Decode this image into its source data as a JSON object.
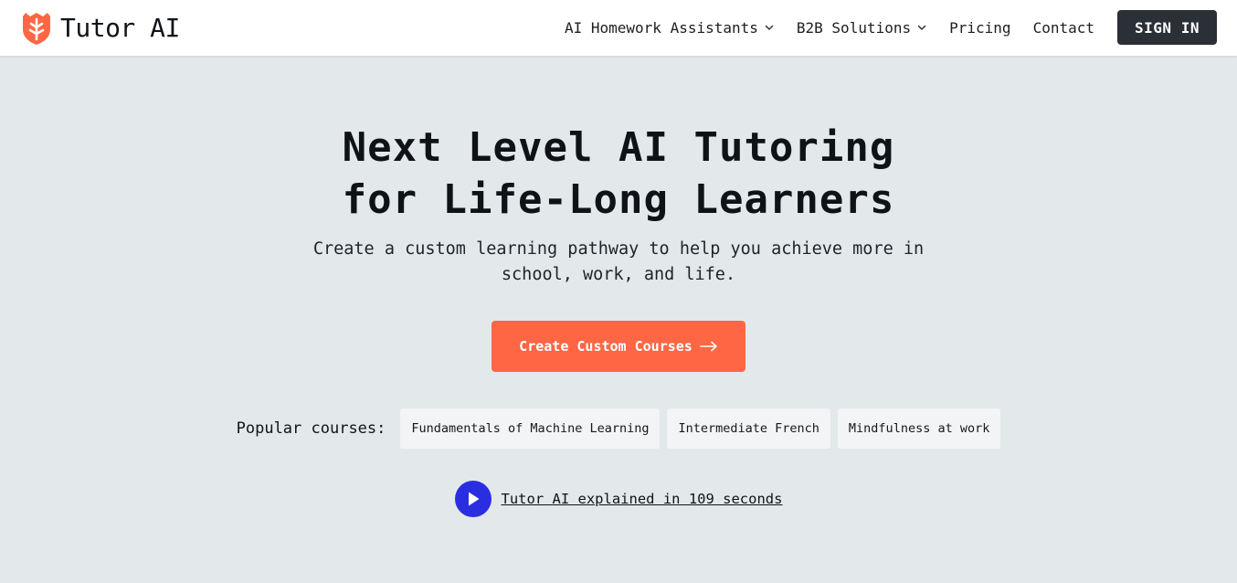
{
  "brand": {
    "name": "Tutor AI",
    "accent_color": "#ff6644"
  },
  "nav": {
    "items": [
      {
        "label": "AI Homework Assistants",
        "has_dropdown": true
      },
      {
        "label": "B2B Solutions",
        "has_dropdown": true
      },
      {
        "label": "Pricing",
        "has_dropdown": false
      },
      {
        "label": "Contact",
        "has_dropdown": false
      }
    ],
    "signin_label": "SIGN IN"
  },
  "hero": {
    "title_line1": "Next Level AI Tutoring",
    "title_line2": "for Life-Long Learners",
    "subtitle_line1": "Create a custom learning pathway to help you achieve more in",
    "subtitle_line2": "school, work, and life.",
    "cta_label": "Create Custom Courses",
    "cta_color": "#ff6644"
  },
  "popular": {
    "label": "Popular courses:",
    "courses": [
      "Fundamentals of Machine Learning",
      "Intermediate French",
      "Mindfulness at work"
    ]
  },
  "video": {
    "label": "Tutor AI explained in 109 seconds",
    "button_color": "#2b2ee0"
  }
}
